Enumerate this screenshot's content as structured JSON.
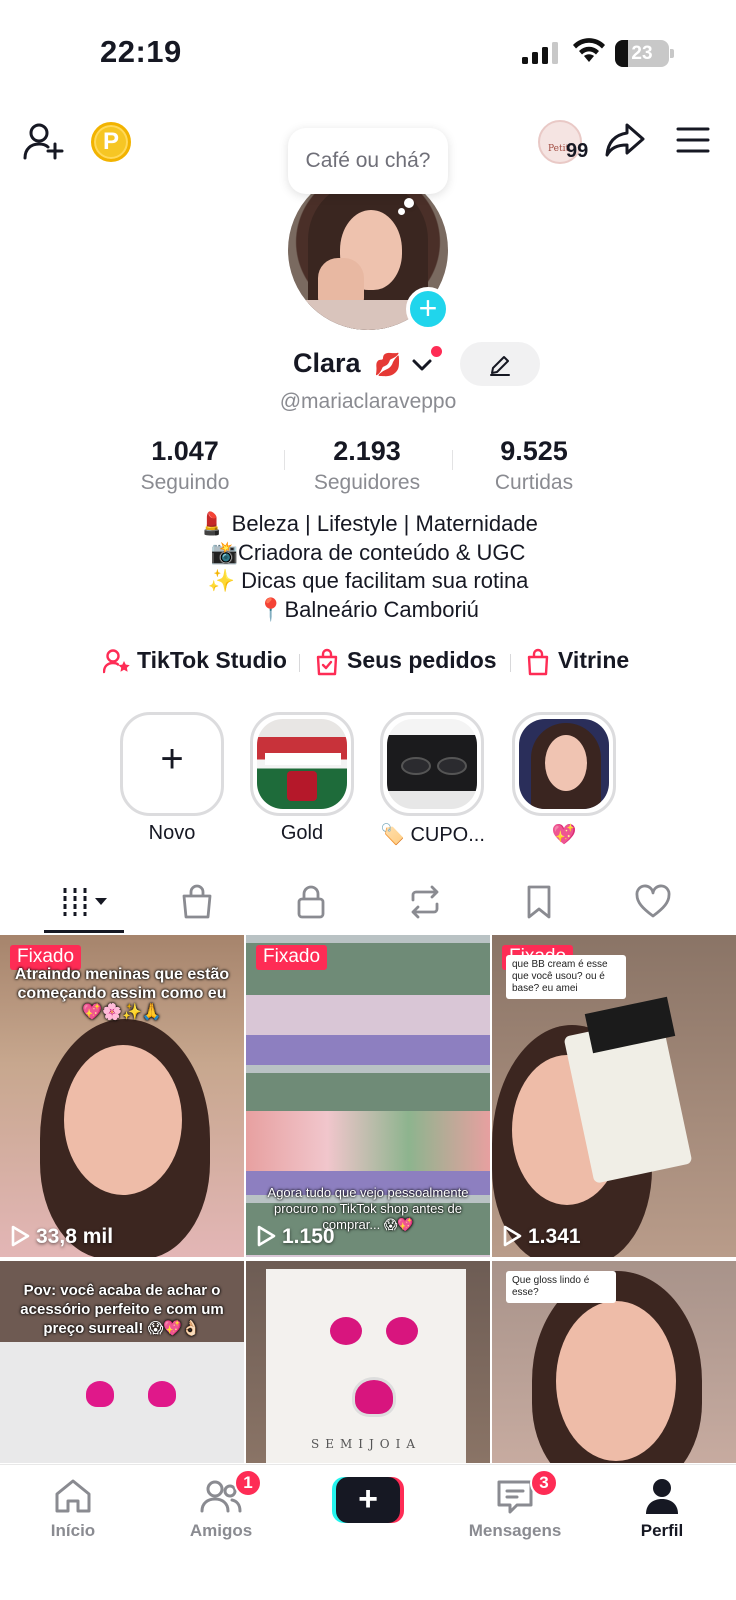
{
  "status": {
    "time": "22:19",
    "battery": "23"
  },
  "topbar": {
    "coin_letter": "P",
    "badge_count": "99",
    "badge_mini": "Petit"
  },
  "bubble": {
    "text": "Café ou chá?"
  },
  "profile": {
    "name": "Clara",
    "name_emoji": "💋",
    "handle": "@mariaclaraveppo"
  },
  "stats": [
    {
      "value": "1.047",
      "label": "Seguindo"
    },
    {
      "value": "2.193",
      "label": "Seguidores"
    },
    {
      "value": "9.525",
      "label": "Curtidas"
    }
  ],
  "bio": [
    "💄 Beleza | Lifestyle | Maternidade",
    "📸Criadora de conteúdo & UGC",
    "✨ Dicas que facilitam sua rotina",
    "📍Balneário Camboriú"
  ],
  "links": [
    {
      "label": "TikTok Studio"
    },
    {
      "label": "Seus pedidos"
    },
    {
      "label": "Vitrine"
    }
  ],
  "highlights": [
    {
      "label": "Novo"
    },
    {
      "label": "Gold"
    },
    {
      "label": "🏷️ CUPO..."
    },
    {
      "label": "💖"
    }
  ],
  "videos": [
    {
      "pinned": "Fixado",
      "views": "33,8 mil",
      "caption": "Atraindo meninas que estão começando assim como eu 💖🌸✨🙏"
    },
    {
      "pinned": "Fixado",
      "views": "1.150",
      "caption": "Agora tudo que vejo pessoalmente procuro no TikTok shop antes de comprar... 😱💖"
    },
    {
      "pinned": "Fixado",
      "views": "1.341",
      "question": "que BB cream é esse que você usou? ou é base? eu amei"
    },
    {
      "caption": "Pov: você acaba de achar o acessório perfeito e com um preço surreal! 😱💖👌🏻"
    },
    {
      "label": "SEMIJOIA"
    },
    {
      "question": "Que gloss lindo é esse?"
    }
  ],
  "nav": [
    {
      "label": "Início"
    },
    {
      "label": "Amigos",
      "badge": "1"
    },
    {
      "label": "Mensagens",
      "badge": "3"
    },
    {
      "label": "Perfil"
    }
  ],
  "colors": {
    "accent": "#fe2c55",
    "cyan": "#20d5ec",
    "muted": "#8a8b91"
  }
}
